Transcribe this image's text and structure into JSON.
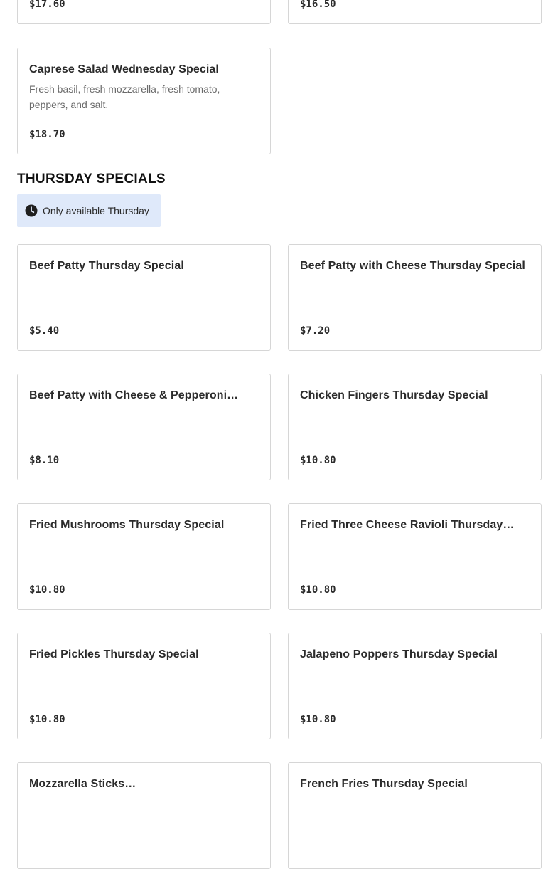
{
  "top_partial": {
    "left_price": "$17.60",
    "right_price": "$16.50"
  },
  "wednesday": {
    "caprese": {
      "name": "Caprese Salad Wednesday Special",
      "description": "Fresh basil, fresh mozzarella, fresh tomato, peppers, and salt.",
      "price": "$18.70"
    }
  },
  "thursday": {
    "title": "THURSDAY SPECIALS",
    "availability": "Only available Thursday",
    "availability_icon": "clock-icon",
    "availability_bg": "#dfe9fa",
    "items": [
      {
        "name": "Beef Patty Thursday Special",
        "price": "$5.40"
      },
      {
        "name": "Beef Patty with Cheese Thursday Special",
        "price": "$7.20"
      },
      {
        "name": "Beef Patty with Cheese & Pepperoni…",
        "price": "$8.10"
      },
      {
        "name": "Chicken Fingers Thursday Special",
        "price": "$10.80"
      },
      {
        "name": "Fried Mushrooms Thursday Special",
        "price": "$10.80"
      },
      {
        "name": "Fried Three Cheese Ravioli Thursday…",
        "price": "$10.80"
      },
      {
        "name": "Fried Pickles Thursday Special",
        "price": "$10.80"
      },
      {
        "name": "Jalapeno Poppers Thursday Special",
        "price": "$10.80"
      },
      {
        "name": "Mozzarella Sticks…",
        "price": ""
      },
      {
        "name": "French Fries Thursday Special",
        "price": ""
      }
    ]
  }
}
